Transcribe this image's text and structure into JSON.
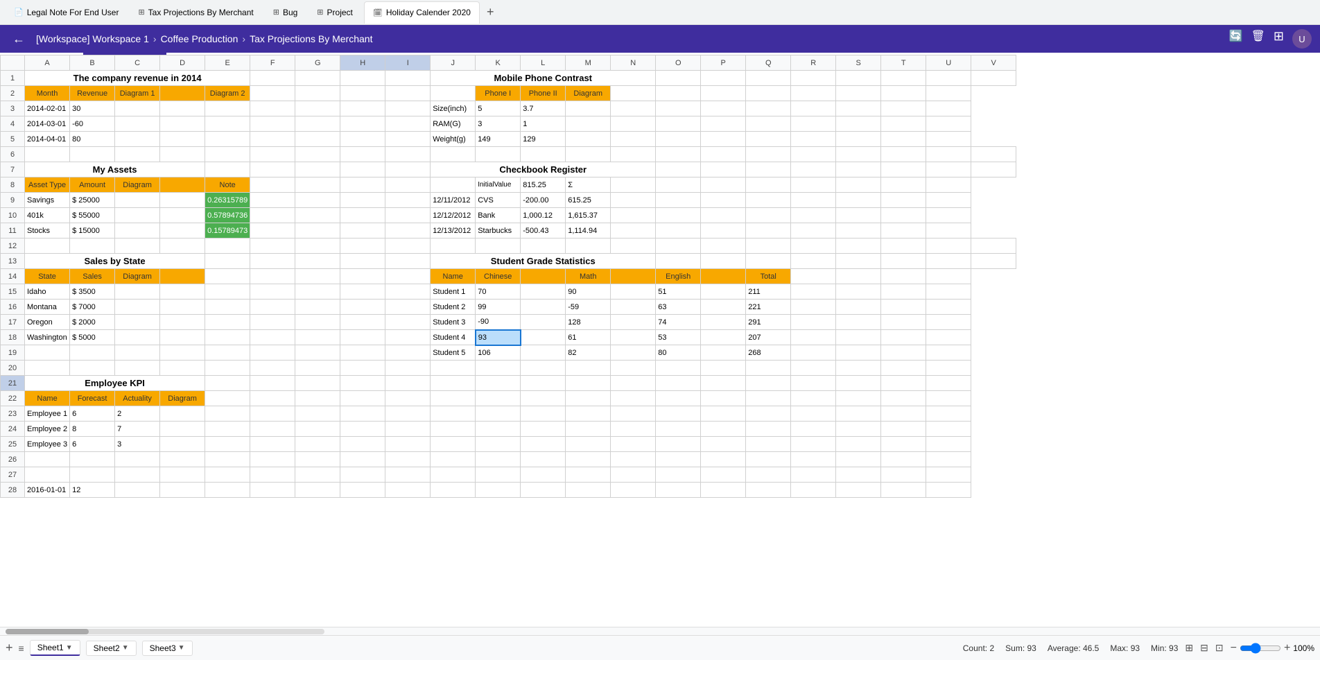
{
  "tabs": [
    {
      "id": "legal",
      "label": "Legal Note For End User",
      "icon": "📄",
      "active": false
    },
    {
      "id": "tax",
      "label": "Tax Projections By Merchant",
      "icon": "📊",
      "active": false
    },
    {
      "id": "bug",
      "label": "Bug",
      "icon": "⊞",
      "active": false
    },
    {
      "id": "project",
      "label": "Project",
      "icon": "⊞",
      "active": false
    },
    {
      "id": "holiday",
      "label": "Holiday Calender 2020",
      "icon": "📅",
      "active": true
    }
  ],
  "breadcrumb": {
    "workspace": "[Workspace] Workspace 1",
    "sep1": "›",
    "sheet": "Coffee Production",
    "sep2": "›",
    "current": "Tax Projections By Merchant"
  },
  "columns": [
    "A",
    "B",
    "C",
    "D",
    "E",
    "F",
    "G",
    "H",
    "I",
    "J",
    "K",
    "L",
    "M",
    "N",
    "O",
    "P",
    "Q",
    "R",
    "S",
    "T",
    "U",
    "V"
  ],
  "sheets": [
    {
      "label": "Sheet1",
      "active": true
    },
    {
      "label": "Sheet2",
      "active": false
    },
    {
      "label": "Sheet3",
      "active": false
    }
  ],
  "status": {
    "count": "Count: 2",
    "sum": "Sum: 93",
    "average": "Average: 46.5",
    "max": "Max: 93",
    "min": "Min: 93",
    "zoom": "100%"
  },
  "sections": {
    "company_revenue": {
      "title": "The company revenue in 2014",
      "headers": [
        "Month",
        "Revenue",
        "Diagram 1",
        "",
        "Diagram 2"
      ],
      "rows": [
        [
          "2014-02-01",
          "30",
          "",
          "",
          ""
        ],
        [
          "2014-03-01",
          "-60",
          "",
          "",
          ""
        ],
        [
          "2014-04-01",
          "80",
          "",
          "",
          ""
        ]
      ]
    },
    "my_assets": {
      "title": "My Assets",
      "headers": [
        "Asset Type",
        "Amount",
        "Diagram",
        "",
        "Note"
      ],
      "rows": [
        [
          "Savings",
          "$ 25000",
          "",
          "",
          "0.26315789"
        ],
        [
          "401k",
          "$ 55000",
          "",
          "",
          "0.57894736"
        ],
        [
          "Stocks",
          "$ 15000",
          "",
          "",
          "0.15789473"
        ]
      ]
    },
    "sales_by_state": {
      "title": "Sales by State",
      "headers": [
        "State",
        "Sales",
        "Diagram"
      ],
      "rows": [
        [
          "Idaho",
          "$ 3500",
          ""
        ],
        [
          "Montana",
          "$ 7000",
          ""
        ],
        [
          "Oregon",
          "$ 2000",
          ""
        ],
        [
          "Washington",
          "$ 5000",
          ""
        ]
      ]
    },
    "employee_kpi": {
      "title": "Employee KPI",
      "headers": [
        "Name",
        "Forecast",
        "Actuality",
        "Diagram"
      ],
      "rows": [
        [
          "Employee 1",
          "6",
          "2",
          ""
        ],
        [
          "Employee 2",
          "8",
          "7",
          ""
        ],
        [
          "Employee 3",
          "6",
          "3",
          ""
        ]
      ]
    },
    "mobile_phone": {
      "title": "Mobile Phone Contrast",
      "headers": [
        "",
        "Phone I",
        "Phone II",
        "Diagram"
      ],
      "rows": [
        [
          "Size(inch)",
          "5",
          "3.7",
          ""
        ],
        [
          "RAM(G)",
          "3",
          "1",
          ""
        ],
        [
          "Weight(g)",
          "149",
          "129",
          ""
        ]
      ]
    },
    "checkbook": {
      "title": "Checkbook Register",
      "initial_label": "InitialValue",
      "initial_value": "815.25",
      "sigma": "Σ",
      "rows": [
        [
          "12/11/2012",
          "CVS",
          "-200.00",
          "615.25"
        ],
        [
          "12/12/2012",
          "Bank",
          "1,000.12",
          "1,615.37"
        ],
        [
          "12/13/2012",
          "Starbucks",
          "-500.43",
          "1,114.94"
        ]
      ]
    },
    "student_grades": {
      "title": "Student Grade Statistics",
      "headers": [
        "Name",
        "Chinese",
        "",
        "Math",
        "",
        "English",
        "",
        "Total"
      ],
      "rows": [
        [
          "Student 1",
          "70",
          "",
          "90",
          "",
          "51",
          "",
          "211"
        ],
        [
          "Student 2",
          "99",
          "",
          "-59",
          "",
          "63",
          "",
          "221"
        ],
        [
          "Student 3",
          "-90",
          "",
          "128",
          "",
          "74",
          "",
          "291"
        ],
        [
          "Student 4",
          "93",
          "",
          "61",
          "",
          "53",
          "",
          "207"
        ],
        [
          "Student 5",
          "106",
          "",
          "82",
          "",
          "80",
          "",
          "268"
        ]
      ]
    }
  },
  "row28": {
    "date": "2016-01-01",
    "value": "12"
  }
}
